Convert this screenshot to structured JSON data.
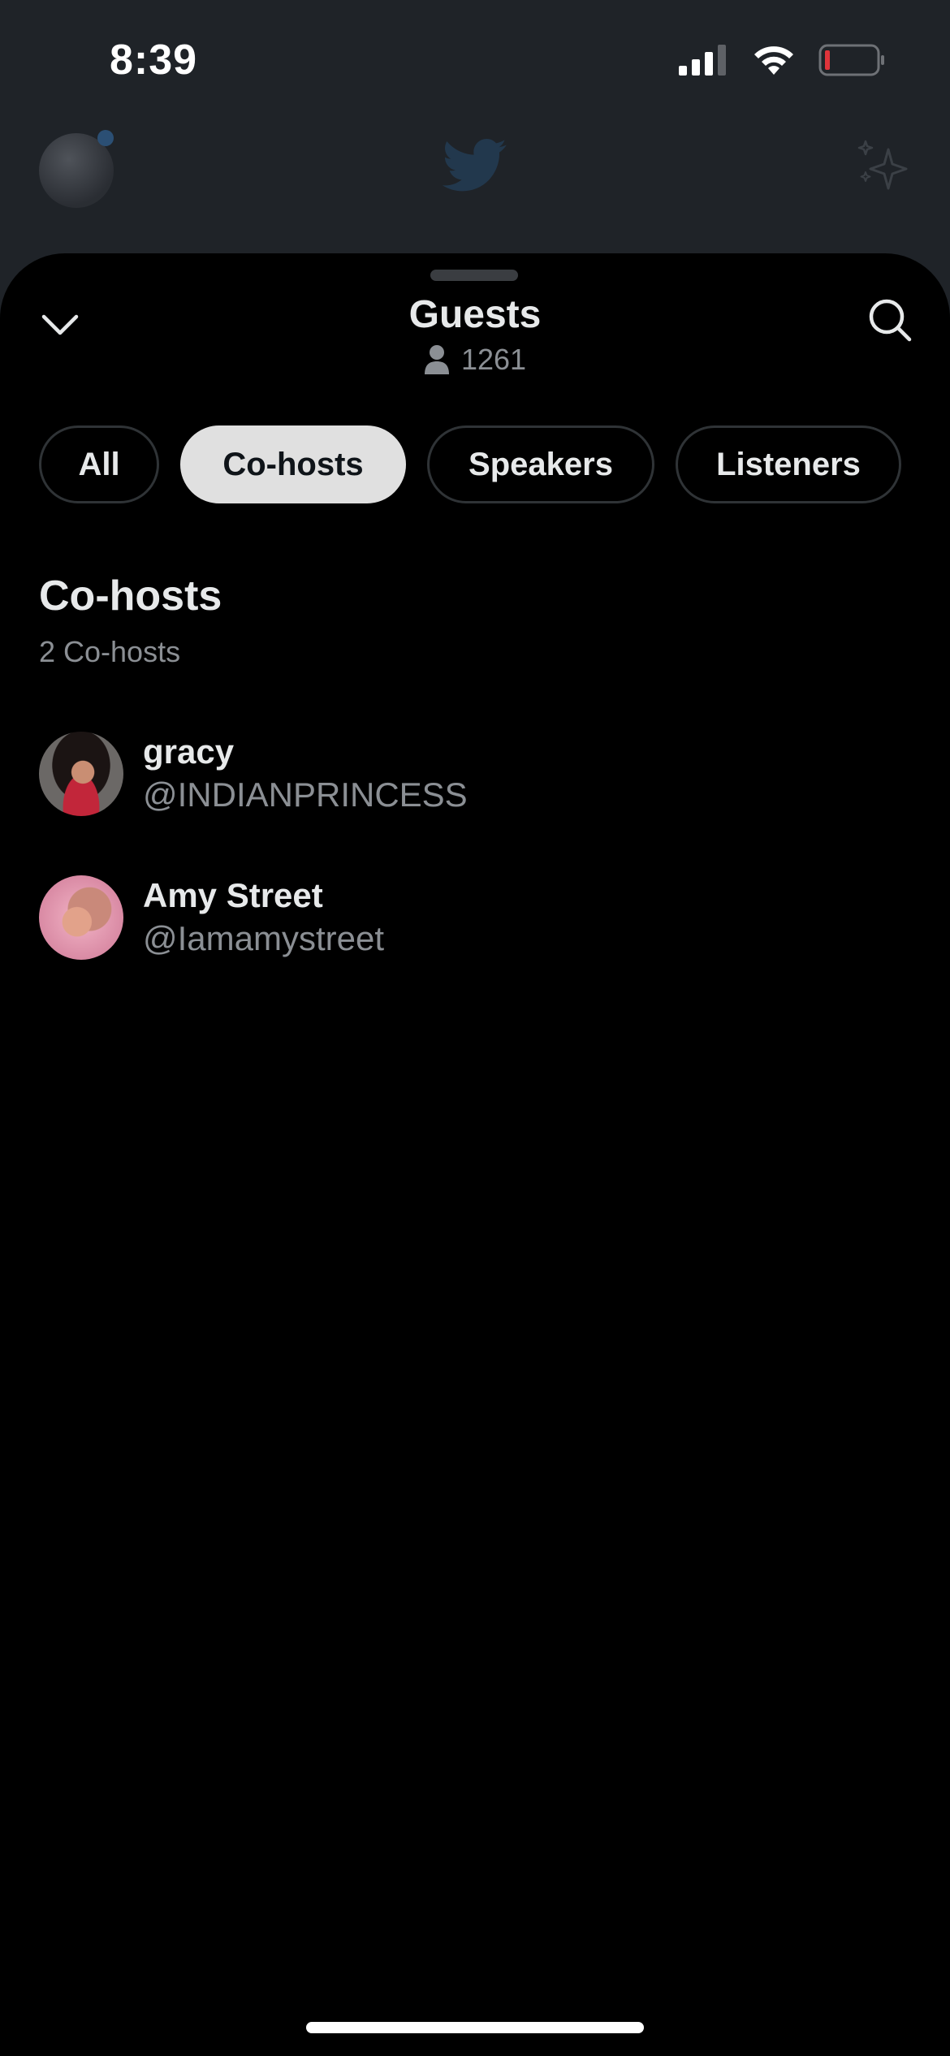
{
  "status_bar": {
    "time": "8:39"
  },
  "sheet": {
    "title": "Guests",
    "guest_count": "1261"
  },
  "tabs": [
    {
      "label": "All",
      "active": false
    },
    {
      "label": "Co-hosts",
      "active": true
    },
    {
      "label": "Speakers",
      "active": false
    },
    {
      "label": "Listeners",
      "active": false
    }
  ],
  "section": {
    "title": "Co-hosts",
    "subtitle": "2 Co-hosts"
  },
  "users": [
    {
      "name": "gracy",
      "handle": "@INDIANPRINCESS"
    },
    {
      "name": "Amy Street",
      "handle": "@Iamamystreet"
    }
  ],
  "icons": {
    "close": "chevron-down-icon",
    "search": "search-icon",
    "person": "person-icon",
    "twitter": "twitter-bird-icon",
    "sparkle": "sparkle-icon"
  },
  "colors": {
    "background": "#000000",
    "active_tab": "#e0e0e0",
    "secondary_text": "#8b8f94"
  }
}
